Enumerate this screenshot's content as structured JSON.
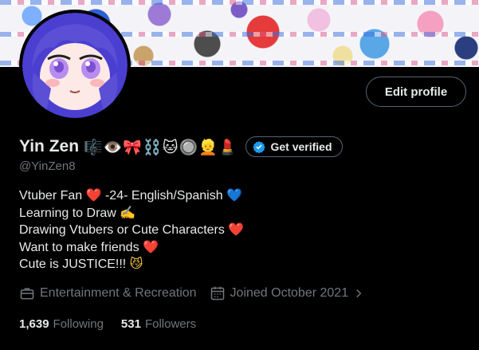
{
  "profile": {
    "name": "Yin Zen",
    "name_emojis": "🎼👁️🎀⛓️🐱🔘👱💄",
    "handle": "@YinZen8",
    "edit_button": "Edit profile",
    "verify_button": "Get verified",
    "verified_badge_color": "#1d9bf0",
    "avatar_hair_color": "#5b4fd6",
    "avatar_eye_color": "#b88cf0"
  },
  "bio": {
    "lines": [
      {
        "before": "Vtuber Fan ",
        "emoji": "❤️",
        "after": " -24- English/Spanish ",
        "emoji2": "💙"
      },
      {
        "before": "Learning to Draw ",
        "emoji": "✍️",
        "after": "",
        "emoji2": ""
      },
      {
        "before": "Drawing Vtubers or Cute Characters ",
        "emoji": "❤️",
        "after": "",
        "emoji2": ""
      },
      {
        "before": "Want to make friends ",
        "emoji": "❤️",
        "after": "",
        "emoji2": ""
      },
      {
        "before": "Cute is JUSTICE!!! ",
        "emoji": "😼",
        "after": "",
        "emoji2": ""
      }
    ]
  },
  "meta": {
    "category": "Entertainment & Recreation",
    "category_icon": "briefcase-icon",
    "joined": "Joined October 2021",
    "joined_icon": "calendar-icon"
  },
  "stats": {
    "following_count": "1,639",
    "following_label": "Following",
    "followers_count": "531",
    "followers_label": "Followers"
  }
}
